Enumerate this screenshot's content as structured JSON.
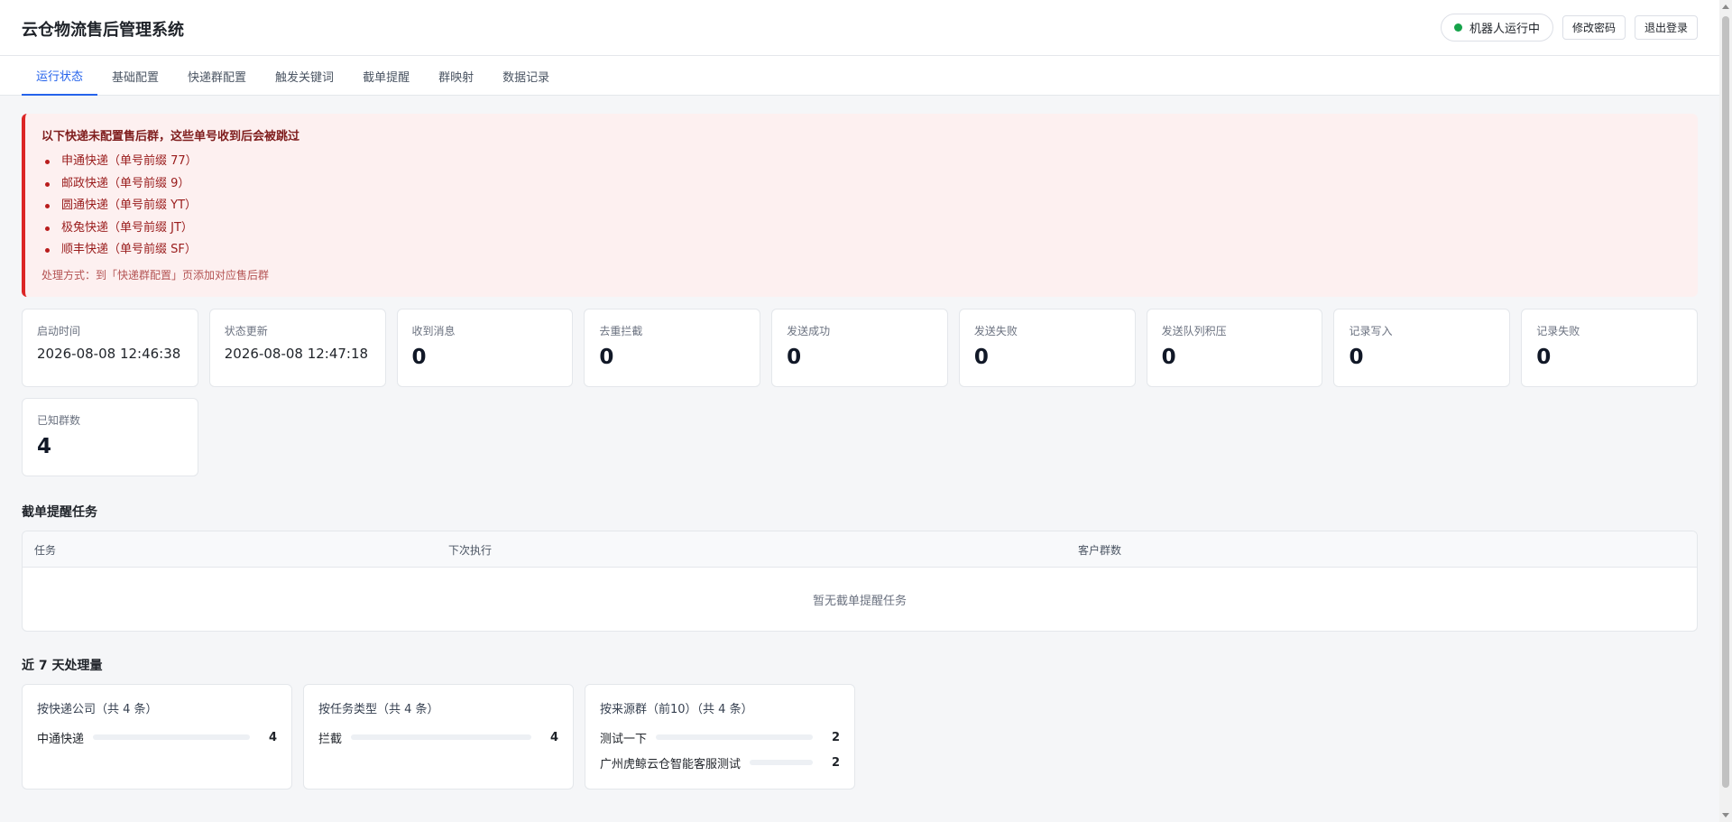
{
  "app": {
    "title": "云仓物流售后管理系统"
  },
  "header": {
    "status_label": "机器人运行中",
    "status_color": "#16a34a",
    "change_password": "修改密码",
    "logout": "退出登录"
  },
  "tabs": [
    {
      "label": "运行状态",
      "active": true
    },
    {
      "label": "基础配置",
      "active": false
    },
    {
      "label": "快递群配置",
      "active": false
    },
    {
      "label": "触发关键词",
      "active": false
    },
    {
      "label": "截单提醒",
      "active": false
    },
    {
      "label": "群映射",
      "active": false
    },
    {
      "label": "数据记录",
      "active": false
    }
  ],
  "alert": {
    "title": "以下快递未配置售后群，这些单号收到后会被跳过",
    "items": [
      "申通快递（单号前缀 77）",
      "邮政快递（单号前缀 9）",
      "圆通快递（单号前缀 YT）",
      "极兔快递（单号前缀 JT）",
      "顺丰快递（单号前缀 SF）"
    ],
    "footer": "处理方式：到「快递群配置」页添加对应售后群"
  },
  "stats": [
    {
      "label": "启动时间",
      "value": "2026-08-08 12:46:38",
      "kind": "time"
    },
    {
      "label": "状态更新",
      "value": "2026-08-08 12:47:18",
      "kind": "time"
    },
    {
      "label": "收到消息",
      "value": "0",
      "kind": "num"
    },
    {
      "label": "去重拦截",
      "value": "0",
      "kind": "num"
    },
    {
      "label": "发送成功",
      "value": "0",
      "kind": "num"
    },
    {
      "label": "发送失败",
      "value": "0",
      "kind": "num"
    },
    {
      "label": "发送队列积压",
      "value": "0",
      "kind": "num"
    },
    {
      "label": "记录写入",
      "value": "0",
      "kind": "num"
    },
    {
      "label": "记录失败",
      "value": "0",
      "kind": "num"
    },
    {
      "label": "已知群数",
      "value": "4",
      "kind": "num"
    }
  ],
  "tasks": {
    "title": "截单提醒任务",
    "columns": [
      "任务",
      "下次执行",
      "客户群数"
    ],
    "empty": "暂无截单提醒任务"
  },
  "weekly": {
    "title": "近 7 天处理量",
    "cards": [
      {
        "title": "按快递公司（共 4 条）",
        "rows": [
          {
            "label": "中通快递",
            "value": 4,
            "fill": 0
          }
        ]
      },
      {
        "title": "按任务类型（共 4 条）",
        "rows": [
          {
            "label": "拦截",
            "value": 4,
            "fill": 0
          }
        ]
      },
      {
        "title": "按来源群（前10）（共 4 条）",
        "rows": [
          {
            "label": "测试一下",
            "value": 2,
            "fill": 0
          },
          {
            "label": "广州虎鲸云仓智能客服测试",
            "value": 2,
            "fill": 0
          }
        ]
      }
    ]
  }
}
